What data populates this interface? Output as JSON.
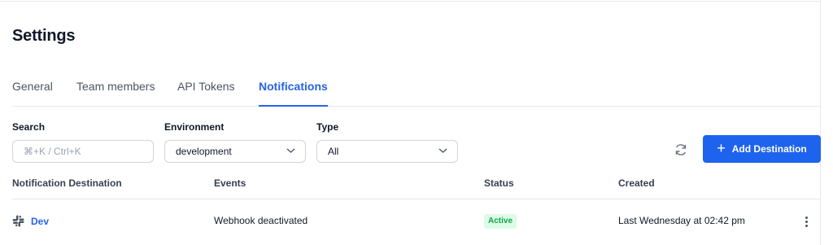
{
  "page": {
    "title": "Settings"
  },
  "tabs": [
    {
      "label": "General",
      "active": false
    },
    {
      "label": "Team members",
      "active": false
    },
    {
      "label": "API Tokens",
      "active": false
    },
    {
      "label": "Notifications",
      "active": true
    }
  ],
  "filters": {
    "search": {
      "label": "Search",
      "placeholder": "⌘+K / Ctrl+K",
      "value": ""
    },
    "environment": {
      "label": "Environment",
      "value": "development"
    },
    "type": {
      "label": "Type",
      "value": "All"
    }
  },
  "actions": {
    "add_destination_label": "Add Destination"
  },
  "table": {
    "columns": [
      "Notification Destination",
      "Events",
      "Status",
      "Created"
    ],
    "rows": [
      {
        "destination": "Dev",
        "destination_icon": "slack-icon",
        "events": "Webhook deactivated",
        "status": "Active",
        "created": "Last Wednesday at 02:42 pm"
      }
    ]
  },
  "colors": {
    "accent": "#1d63ed",
    "active_tab": "#2563eb",
    "status_bg": "#dcfce7",
    "status_text": "#16a34a"
  }
}
